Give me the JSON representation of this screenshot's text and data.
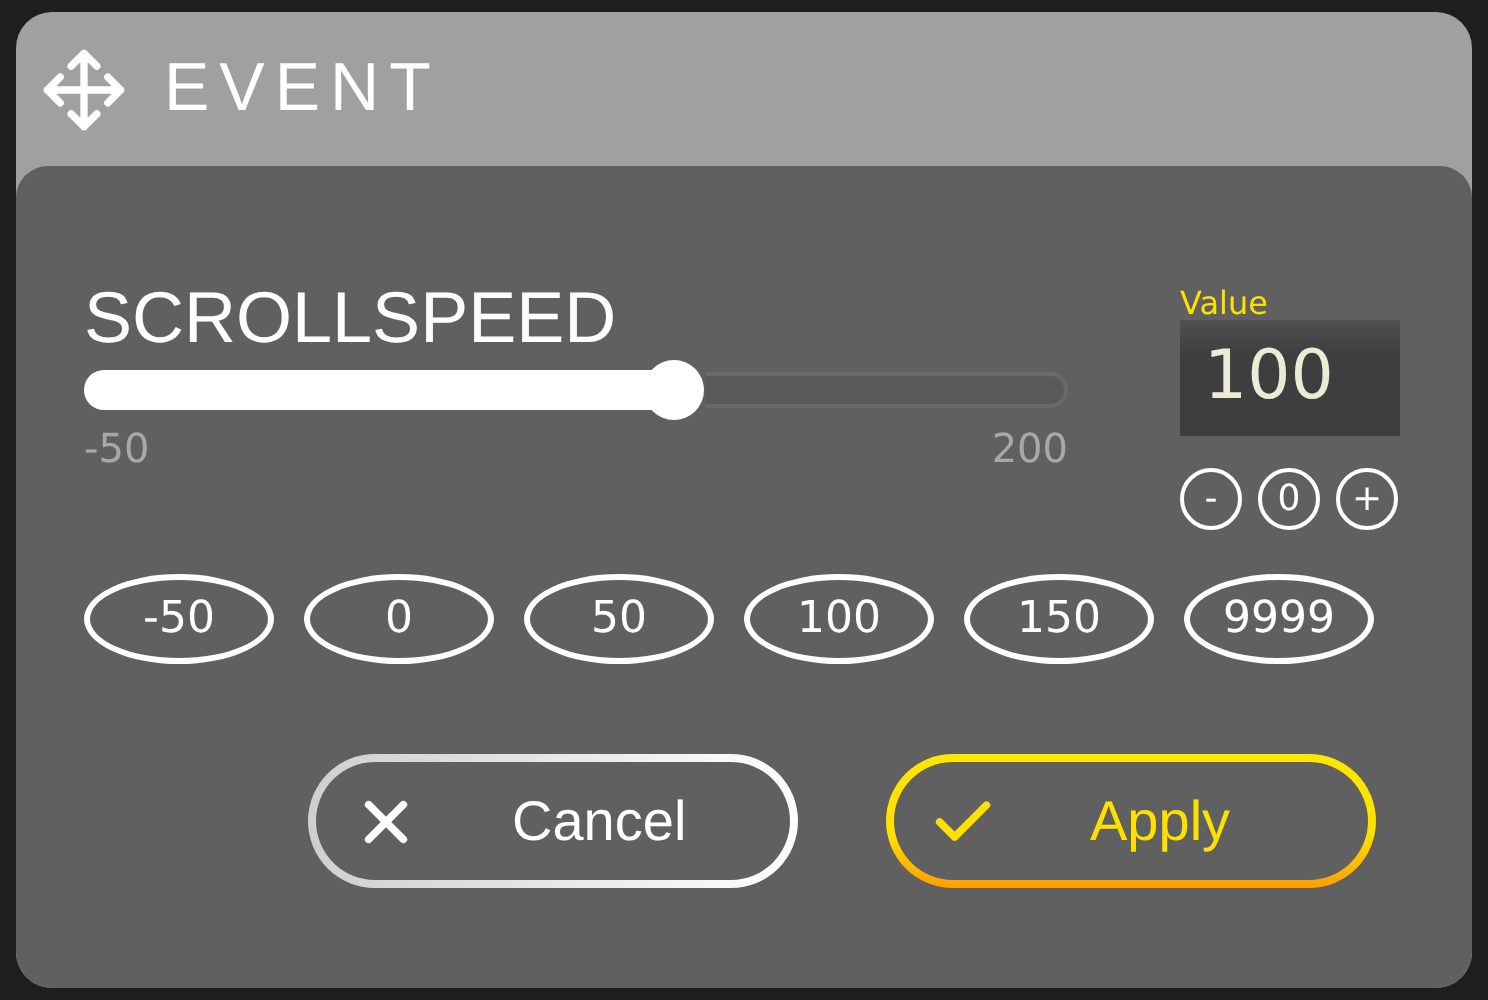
{
  "window": {
    "title": "EVENT"
  },
  "slider": {
    "label": "SCROLLSPEED",
    "level": 0.6,
    "min_label": "-50",
    "max_label": "200"
  },
  "value": {
    "label": "Value",
    "value": "100"
  },
  "steppers": [
    "-",
    "0",
    "+"
  ],
  "presets": [
    "-50",
    "0",
    "50",
    "100",
    "150",
    "9999"
  ],
  "buttons": [
    {
      "kind": "cancel",
      "label": "Cancel"
    },
    {
      "kind": "apply",
      "label": "Apply"
    }
  ]
}
